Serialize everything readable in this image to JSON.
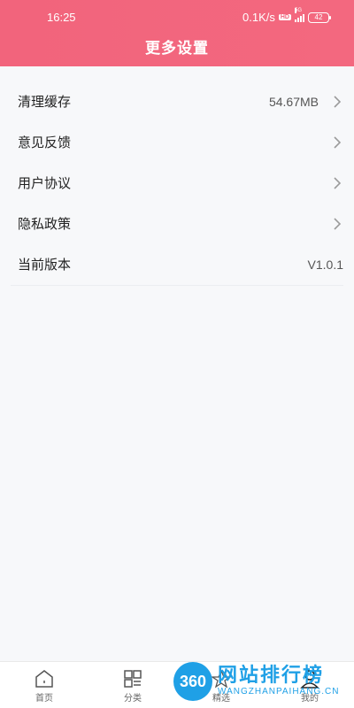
{
  "status_bar": {
    "time": "16:25",
    "network_speed": "0.1K/s",
    "hd_badge": "HD",
    "network_type": "5G",
    "battery": "42"
  },
  "header": {
    "title": "更多设置"
  },
  "settings": [
    {
      "label": "清理缓存",
      "value": "54.67MB"
    },
    {
      "label": "意见反馈"
    },
    {
      "label": "用户协议"
    },
    {
      "label": "隐私政策"
    },
    {
      "label": "当前版本",
      "value": "V1.0.1"
    }
  ],
  "tabbar": {
    "tabs": [
      {
        "label": "首页",
        "icon": "home-icon"
      },
      {
        "label": "分类",
        "icon": "category-icon"
      },
      {
        "label": "精选",
        "icon": "featured-icon"
      },
      {
        "label": "我的",
        "icon": "profile-icon"
      }
    ]
  },
  "watermark": {
    "logo": "360",
    "name": "网站排行榜",
    "domain": "WANGZHANPAIHANG.CN"
  },
  "colors": {
    "header": "#f2647c",
    "background": "#f7f8fa",
    "watermark": "#1fa0e6"
  }
}
